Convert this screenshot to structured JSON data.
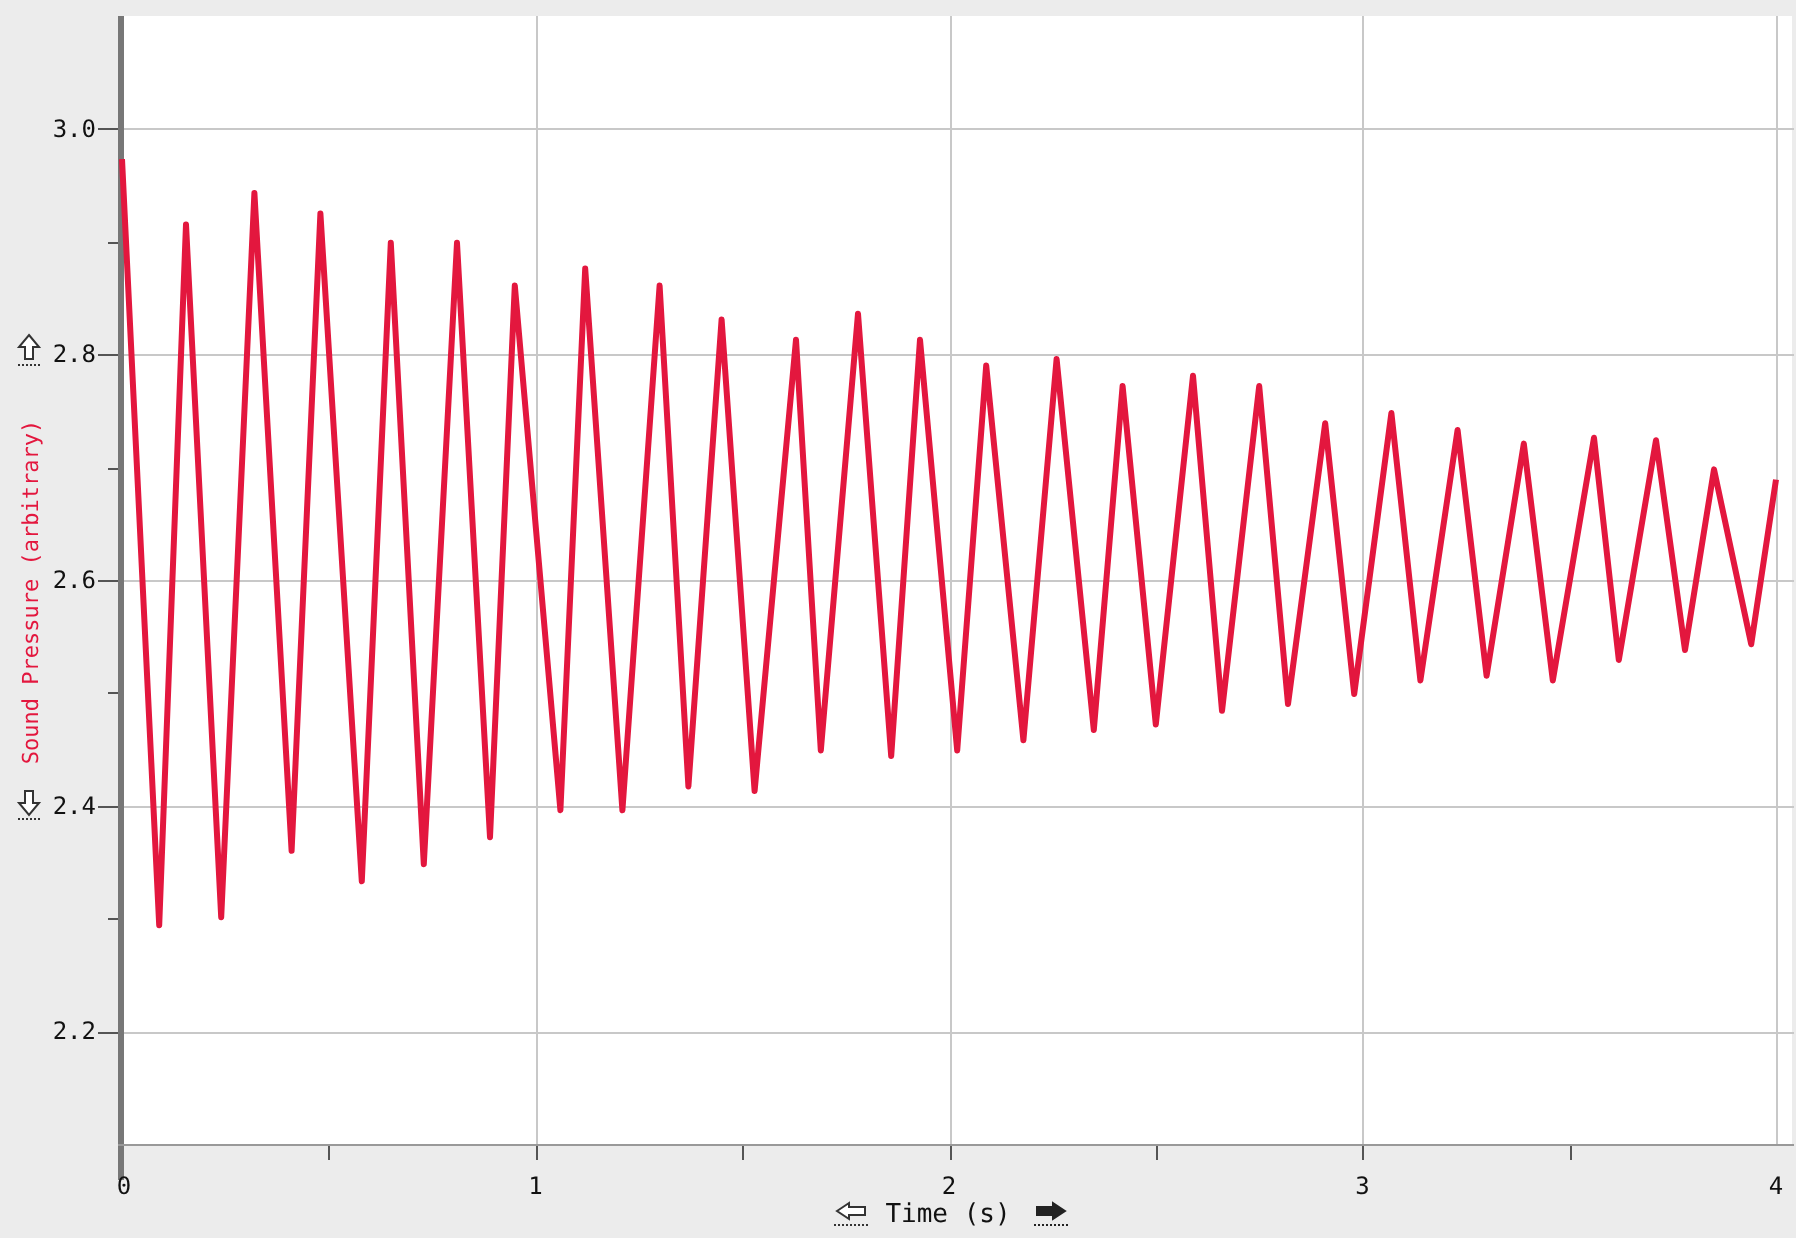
{
  "chart_data": {
    "type": "line",
    "grid": true,
    "xlabel": "Time (s)",
    "ylabel": "Sound Pressure (arbitrary)",
    "xlim": [
      0,
      4
    ],
    "ylim": [
      2.1,
      3.1
    ],
    "xticks": [
      0,
      1,
      2,
      3,
      4
    ],
    "yticks": [
      {
        "value": 2.2,
        "label": "2.2"
      },
      {
        "value": 2.4,
        "label": "2.4"
      },
      {
        "value": 2.6,
        "label": "2.6"
      },
      {
        "value": 2.8,
        "label": "2.8"
      },
      {
        "value": 3.0,
        "label": "3.0"
      }
    ],
    "x": [
      0,
      0.09,
      0.155,
      0.24,
      0.32,
      0.41,
      0.48,
      0.58,
      0.65,
      0.73,
      0.81,
      0.89,
      0.95,
      1.06,
      1.12,
      1.21,
      1.3,
      1.37,
      1.45,
      1.53,
      1.63,
      1.69,
      1.78,
      1.86,
      1.93,
      2.02,
      2.09,
      2.18,
      2.26,
      2.35,
      2.42,
      2.5,
      2.59,
      2.66,
      2.75,
      2.82,
      2.91,
      2.98,
      3.07,
      3.14,
      3.23,
      3.3,
      3.39,
      3.46,
      3.56,
      3.62,
      3.71,
      3.78,
      3.85,
      3.94,
      4.0
    ],
    "series": [
      {
        "color": "#e3173e",
        "values": [
          2.973,
          2.294,
          2.915,
          2.301,
          2.943,
          2.36,
          2.925,
          2.333,
          2.899,
          2.348,
          2.899,
          2.372,
          2.861,
          2.396,
          2.876,
          2.396,
          2.861,
          2.417,
          2.831,
          2.413,
          2.813,
          2.449,
          2.836,
          2.444,
          2.813,
          2.449,
          2.79,
          2.458,
          2.796,
          2.467,
          2.772,
          2.472,
          2.781,
          2.484,
          2.772,
          2.49,
          2.739,
          2.499,
          2.748,
          2.511,
          2.733,
          2.515,
          2.721,
          2.511,
          2.726,
          2.529,
          2.724,
          2.538,
          2.698,
          2.543,
          2.689
        ]
      }
    ]
  }
}
